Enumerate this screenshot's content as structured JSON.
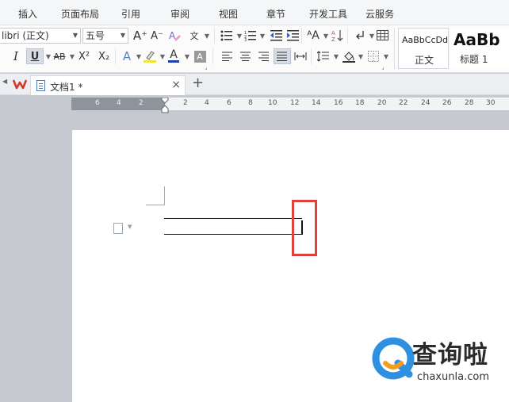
{
  "menu": {
    "items": [
      "插入",
      "页面布局",
      "引用",
      "审阅",
      "视图",
      "章节",
      "开发工具",
      "云服务"
    ]
  },
  "ribbon": {
    "font_name": "libri (正文)",
    "font_size": "五号",
    "grow_font": "A+",
    "shrink_font": "A-",
    "italic": "I",
    "underline": "U",
    "strikethrough": "AB",
    "superscript": "X²",
    "subscript": "X₂",
    "text_effect": "A",
    "font_color": "A",
    "char_shading": "A",
    "phonetic": "文",
    "style_normal_sample": "AaBbCcDd",
    "style_normal_label": "正文",
    "style_heading1_sample": "AaBb",
    "style_heading1_label": "标题 1"
  },
  "tabs": {
    "doc_name": "文档1 *",
    "close": "×",
    "new_tab": "+"
  },
  "ruler": {
    "left_ticks": [
      "6",
      "4",
      "2"
    ],
    "right_ticks": [
      "2",
      "4",
      "6",
      "8",
      "10",
      "12",
      "14",
      "16",
      "18",
      "20",
      "22",
      "24",
      "26",
      "28",
      "30"
    ]
  },
  "watermark": {
    "text": "查询啦",
    "url": "chaxunla.com"
  },
  "colors": {
    "highlight_box": "#e0403e",
    "wps_logo": "#d8352a",
    "font_color_bar": "#1f3fb0",
    "highlight_color_bar": "#f5e33a",
    "watermark_blue": "#2f8fe0",
    "watermark_orange": "#f39c1e"
  }
}
